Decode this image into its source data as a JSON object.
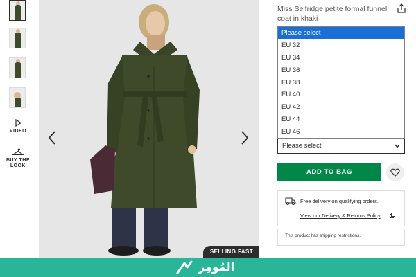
{
  "sidebar": {
    "video_label": "VIDEO",
    "buy_look_label": "BUY THE LOOK",
    "thumbnails": [
      "thumbnail-1",
      "thumbnail-2",
      "thumbnail-3",
      "thumbnail-4"
    ]
  },
  "hero": {
    "badge": "SELLING FAST",
    "prev_icon": "chevron-left-icon",
    "next_icon": "chevron-right-icon"
  },
  "product": {
    "title": "Miss Selfridge petite formal funnel coat in khaki",
    "share_icon": "share-icon"
  },
  "size": {
    "options": [
      "Please select",
      "EU 32",
      "EU 34",
      "EU 36",
      "EU 38",
      "EU 40",
      "EU 42",
      "EU 44",
      "EU 46"
    ],
    "selected": "Please select"
  },
  "actions": {
    "add_to_bag": "ADD TO BAG",
    "wishlist_icon": "heart-icon"
  },
  "delivery": {
    "free_delivery": "Free delivery on qualifying orders.",
    "policy_link": "View our Delivery & Returns Policy",
    "restriction_link": "This product has shipping restrictions."
  },
  "footer": {
    "logo_text": "المُومِر"
  },
  "colors": {
    "accent_green": "#018849",
    "select_highlight": "#1a6fd6",
    "footer_teal": "#29b598",
    "coat_khaki": "#3e4a2a"
  }
}
